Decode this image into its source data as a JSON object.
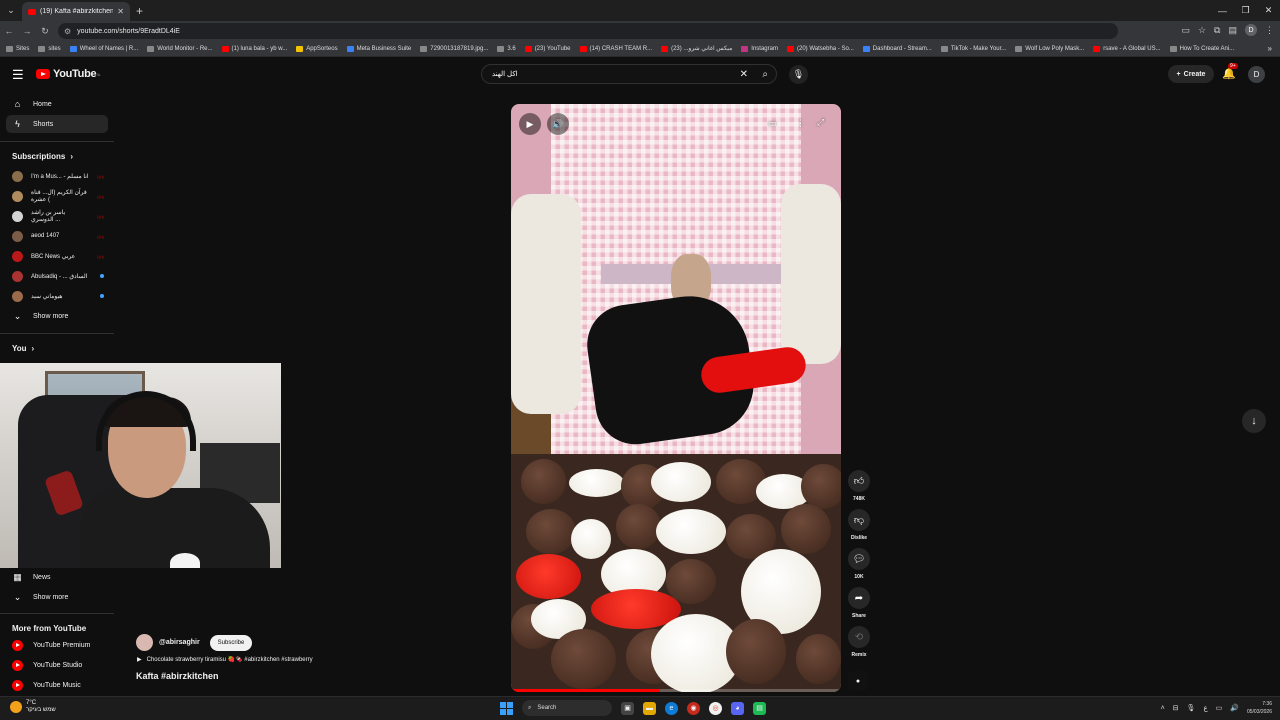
{
  "browser": {
    "tab_title": "(19) Kafta #abirzkitchen - YouTub",
    "url": "youtube.com/shorts/9EradtDL4iE",
    "profile_initial": "D",
    "bookmarks": [
      {
        "label": "Sites",
        "icon": "apps-icon"
      },
      {
        "label": "sites",
        "icon": "folder-icon"
      },
      {
        "label": "Wheel of Names | R...",
        "icon": "wheel-icon"
      },
      {
        "label": "World Monitor - Re...",
        "icon": "globe-icon"
      },
      {
        "label": "(1) luna bala - yb w...",
        "icon": "youtube-icon"
      },
      {
        "label": "AppSorteos",
        "icon": "app-icon"
      },
      {
        "label": "Meta Business Suite",
        "icon": "meta-icon"
      },
      {
        "label": "7290013187819.jpg...",
        "icon": "globe-icon"
      },
      {
        "label": "3.6",
        "icon": "folder-icon"
      },
      {
        "label": "(23) YouTube",
        "icon": "youtube-icon"
      },
      {
        "label": "(14) CRASH TEAM R...",
        "icon": "youtube-icon"
      },
      {
        "label": "ميكس اغاني شرو... (23)",
        "icon": "youtube-icon"
      },
      {
        "label": "Instagram",
        "icon": "instagram-icon"
      },
      {
        "label": "(20) Watsebha - So...",
        "icon": "youtube-icon"
      },
      {
        "label": "Dashboard - Stream...",
        "icon": "dashboard-icon"
      },
      {
        "label": "TikTok - Make Your...",
        "icon": "tiktok-icon"
      },
      {
        "label": "Wolf Low Poly Mask...",
        "icon": "bookmark-icon"
      },
      {
        "label": "rsave - A Global US...",
        "icon": "bookmark-icon"
      },
      {
        "label": "How To Create Ani...",
        "icon": "bookmark-icon"
      }
    ]
  },
  "youtube": {
    "logo_text": "YouTube",
    "logo_country": "IL",
    "search_query": "اكل الهند",
    "create_label": "Create",
    "notif_count": "9+",
    "avatar_initial": "D"
  },
  "sidebar": {
    "home": "Home",
    "shorts": "Shorts",
    "subscriptions_header": "Subscriptions",
    "subscriptions": [
      {
        "name": "I'm a Mus... - انا مسلم",
        "status": "live",
        "color": "#8a6d4b"
      },
      {
        "name": "قرآن الكريم (ال... قناة ) عشرة",
        "status": "live",
        "color": "#b08b5e"
      },
      {
        "name": "ياسر بن راشد الدوسري ...",
        "status": "live",
        "color": "#d4d4d4"
      },
      {
        "name": "aeod 1407",
        "status": "live",
        "color": "#7a5c48"
      },
      {
        "name": "BBC News عربي",
        "status": "live",
        "color": "#bb1919"
      },
      {
        "name": "Abulsadiq - ... السادق",
        "status": "dot",
        "color": "#a33"
      },
      {
        "name": "هيوماني سيد",
        "status": "dot",
        "color": "#9a6a4a"
      }
    ],
    "show_more_1": "Show more",
    "you_header": "You",
    "news": "News",
    "show_more_2": "Show more",
    "more_from_header": "More from YouTube",
    "more_from": [
      "YouTube Premium",
      "YouTube Studio",
      "YouTube Music"
    ]
  },
  "short": {
    "channel": "@abirsaghir",
    "subscribe_label": "Subscribe",
    "music_text": "Chocolate strawberry tiramisu 🍓🍫 #abirzkitchen #strawberry",
    "title": "Kafta #abirzkitchen",
    "progress": 0.45,
    "actions": {
      "like_count": "748K",
      "dislike_label": "Dislike",
      "comment_count": "10K",
      "share_label": "Share",
      "remix_label": "Remix"
    }
  },
  "taskbar": {
    "weather_temp": "7°C",
    "weather_text": "שמש בעיקר",
    "search_placeholder": "Search",
    "time": "7:36",
    "date": "05/03/2026",
    "lang": "ع"
  }
}
